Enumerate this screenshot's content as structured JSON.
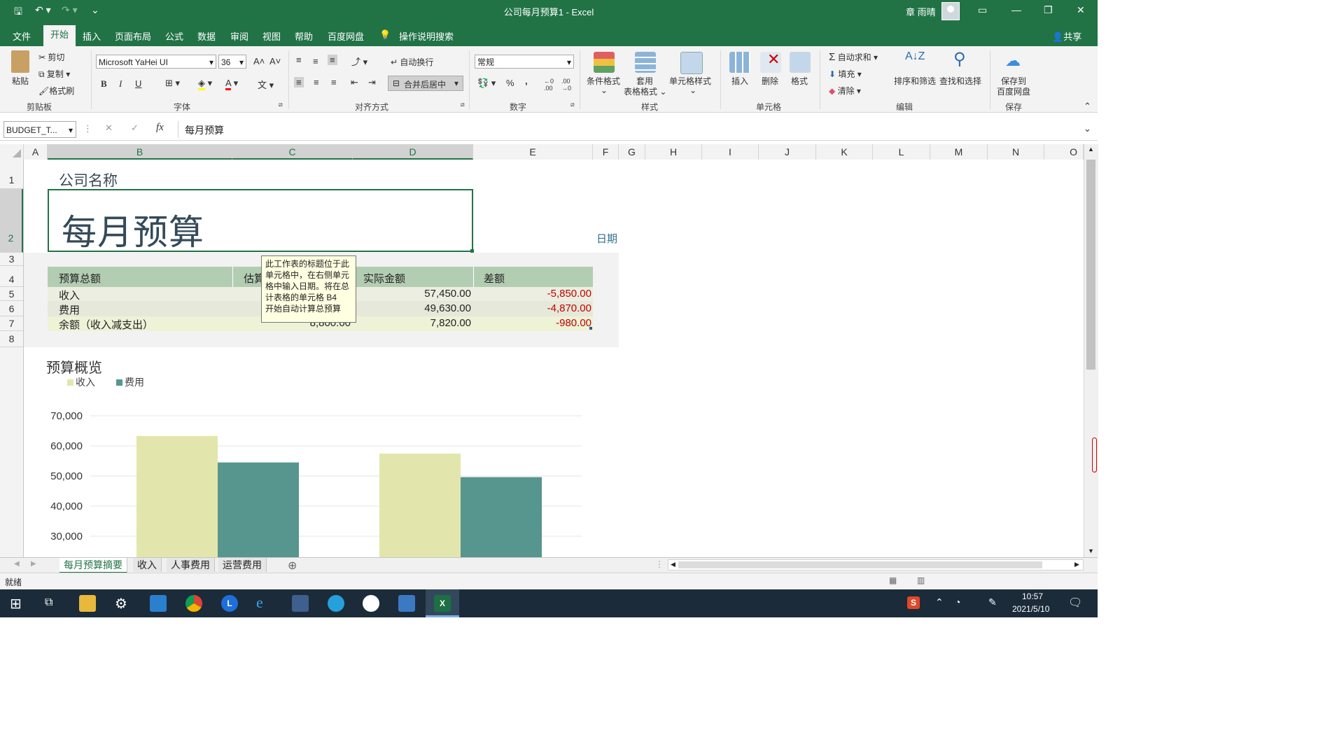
{
  "window": {
    "title": "公司每月预算1 - Excel",
    "user": "章 雨晴"
  },
  "ribbon_tabs": [
    "文件",
    "开始",
    "插入",
    "页面布局",
    "公式",
    "数据",
    "审阅",
    "视图",
    "帮助",
    "百度网盘"
  ],
  "tell_me": "操作说明搜索",
  "share": "共享",
  "clipboard": {
    "paste": "粘贴",
    "cut": "剪切",
    "copy": "复制",
    "format_painter": "格式刷",
    "group": "剪贴板"
  },
  "font": {
    "name": "Microsoft YaHei UI",
    "size": "36",
    "group": "字体",
    "bold": "B",
    "italic": "I",
    "underline": "U"
  },
  "alignment": {
    "wrap": "自动换行",
    "merge": "合并后居中",
    "group": "对齐方式"
  },
  "number": {
    "format": "常规",
    "group": "数字",
    "percent": "%",
    "comma": ","
  },
  "styles": {
    "conditional": "条件格式",
    "table1": "套用",
    "table2": "表格格式",
    "cell_styles": "单元格样式",
    "group": "样式"
  },
  "cells": {
    "insert": "插入",
    "delete": "删除",
    "format": "格式",
    "group": "单元格"
  },
  "editing": {
    "autosum": "自动求和",
    "fill": "填充",
    "clear": "清除",
    "sort": "排序和筛选",
    "find": "查找和选择",
    "group": "编辑"
  },
  "save": {
    "line1": "保存到",
    "line2": "百度网盘",
    "group": "保存"
  },
  "formula_bar": {
    "name_box": "BUDGET_T...",
    "fx": "fx",
    "content": "每月预算"
  },
  "columns": [
    "A",
    "B",
    "C",
    "D",
    "E",
    "F",
    "G",
    "H",
    "I",
    "J",
    "K",
    "L",
    "M",
    "N",
    "O"
  ],
  "rows": [
    "1",
    "2",
    "3",
    "4",
    "5",
    "6",
    "7",
    "8"
  ],
  "sheet": {
    "company_name": "公司名称",
    "title": "每月预算",
    "date_label": "日期",
    "table": {
      "headers": [
        "预算总额",
        "估算",
        "实际金额",
        "差额"
      ],
      "rows": [
        {
          "label": "收入",
          "estimate": "",
          "actual": "57,450.00",
          "diff": "-5,850.00"
        },
        {
          "label": "费用",
          "estimate": "",
          "actual": "49,630.00",
          "diff": "-4,870.00"
        },
        {
          "label": "余额（收入减支出）",
          "estimate": "8,800.00",
          "actual": "7,820.00",
          "diff": "-980.00"
        }
      ]
    }
  },
  "tooltip": [
    "此工作表的标题位于此",
    "单元格中，在右侧单元",
    "格中输入日期。将在总",
    "计表格的单元格 B4",
    "开始自动计算总预算"
  ],
  "chart_data": {
    "type": "bar",
    "title": "预算概览",
    "categories": [
      "",
      ""
    ],
    "series": [
      {
        "name": "收入",
        "values": [
          63300,
          57450
        ],
        "color": "#e2e6ac"
      },
      {
        "name": "费用",
        "values": [
          54500,
          49630
        ],
        "color": "#56968e"
      }
    ],
    "yticks": [
      "70,000",
      "60,000",
      "50,000",
      "40,000",
      "30,000"
    ],
    "ylim": [
      30000,
      70000
    ],
    "grid": true,
    "legend": "top-left"
  },
  "sheet_tabs": [
    "每月预算摘要",
    "收入",
    "人事费用",
    "运营费用"
  ],
  "status": "就绪",
  "clock": {
    "time": "10:57",
    "date": "2021/5/10"
  }
}
